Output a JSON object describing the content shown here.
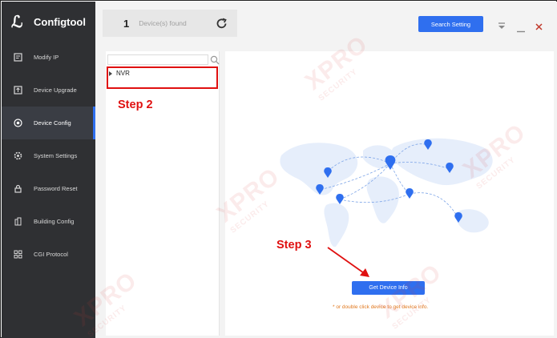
{
  "app": {
    "title": "Configtool"
  },
  "sidebar": {
    "items": [
      {
        "label": "Modify IP",
        "icon": "modify-ip-icon"
      },
      {
        "label": "Device Upgrade",
        "icon": "upgrade-icon"
      },
      {
        "label": "Device Config",
        "icon": "device-config-icon",
        "active": true
      },
      {
        "label": "System Settings",
        "icon": "settings-icon"
      },
      {
        "label": "Password Reset",
        "icon": "lock-icon"
      },
      {
        "label": "Building Config",
        "icon": "building-icon"
      },
      {
        "label": "CGI Protocol",
        "icon": "protocol-icon"
      }
    ]
  },
  "topbar": {
    "found_count": "1",
    "found_label": "Device(s) found",
    "search_setting_label": "Search Setting"
  },
  "tree": {
    "search_placeholder": "",
    "node_label": "NVR"
  },
  "main": {
    "get_device_info_label": "Get Device Info",
    "hint": "* or double click device to get device info."
  },
  "annotations": {
    "step2": "Step 2",
    "step3": "Step 3"
  },
  "watermark": {
    "big": "XPRO",
    "small": "SECURITY"
  },
  "colors": {
    "accent": "#2f6fef",
    "sidebar_bg": "#2f3033",
    "annotation_red": "#e01010",
    "hint_orange": "#e0781e"
  }
}
